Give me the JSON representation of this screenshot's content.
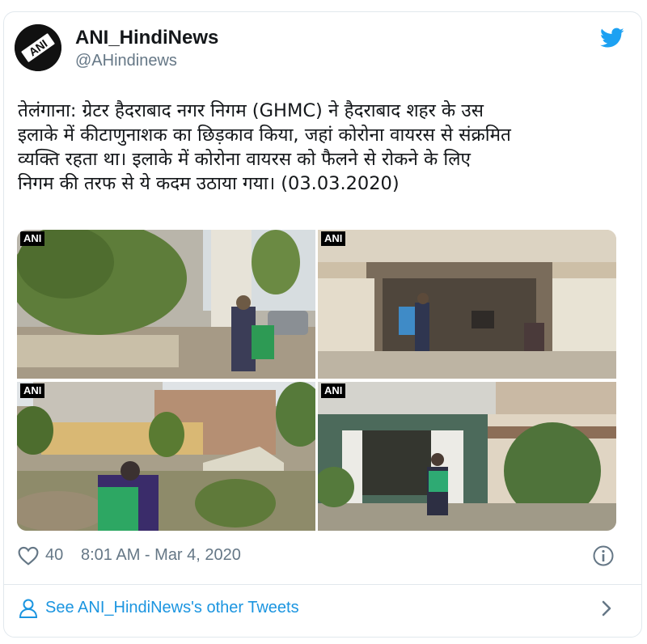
{
  "tweet": {
    "display_name": "ANI_HindiNews",
    "handle": "@AHindinews",
    "text": "तेलंगाना: ग्रेटर हैदराबाद नगर निगम (GHMC) ने हैदराबाद शहर के उस\nइलाके में कीटाणुनाशक का छिड़काव किया, जहां कोरोना वायरस से संक्रमित\nव्यक्ति रहता था। इलाके में कोरोना वायरस को फैलने से रोकने के लिए\nनिगम की तरफ से ये कदम उठाया गया। (03.03.2020)",
    "avatar_text": "ANI",
    "photos": [
      {
        "watermark": "ANI"
      },
      {
        "watermark": "ANI"
      },
      {
        "watermark": "ANI"
      },
      {
        "watermark": "ANI"
      }
    ],
    "likes": "40",
    "timestamp": "8:01 AM - Mar 4, 2020",
    "see_more_label": "See ANI_HindiNews's other Tweets"
  },
  "colors": {
    "twitter_blue": "#1da1f2",
    "link_blue": "#1b95e0",
    "text_dark": "#14171a",
    "text_gray": "#657786",
    "border": "#e1e8ed"
  },
  "icons": [
    "twitter-bird-icon",
    "heart-icon",
    "info-icon",
    "person-icon",
    "chevron-right-icon"
  ]
}
